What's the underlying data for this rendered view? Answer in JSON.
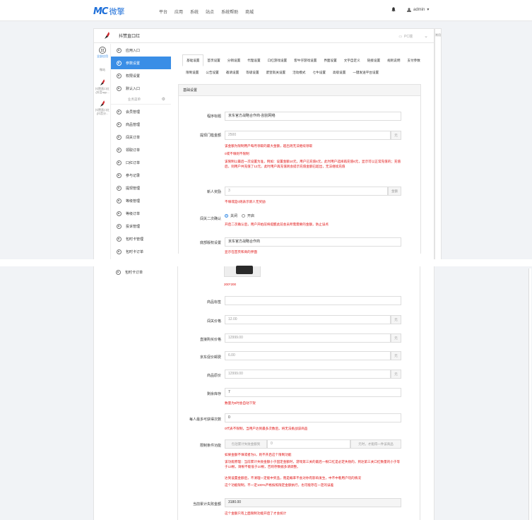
{
  "brand": {
    "logo_mark": "MC",
    "logo_text": "微擎",
    "accent": "#1e6fd9"
  },
  "topnav": [
    "平台",
    "应用",
    "系统",
    "站点",
    "系统帮助",
    "商城"
  ],
  "user": {
    "name": "admin"
  },
  "app": {
    "name": "抖赞直口红",
    "device_label": "PC端"
  },
  "right_edge": "常用",
  "icon_col": [
    {
      "label": "全部应用"
    },
    {
      "label": "微站"
    },
    {
      "label": "抖赞直口红 (抖音app..."
    },
    {
      "label": "抖赞直口红 (抖音分..."
    }
  ],
  "sidebar": {
    "top_items": [
      "应用入口",
      "参数设置",
      "权限设置",
      "默认入口"
    ],
    "section_title": "业务菜单",
    "section_items": [
      "会员管理",
      "商品管理",
      "闯关订单",
      "领取订单",
      "口红订单",
      "参与记录",
      "提现管理",
      "等级管理",
      "等级订单",
      "投诉管理",
      "包时卡管理",
      "包时卡订单",
      "包时卡订单"
    ]
  },
  "tabs": [
    "基础设置",
    "首页设置",
    "分销设置",
    "代理设置",
    "口红游戏设置",
    "客牛仔游戏设置",
    "界面设置",
    "文字自定义",
    "链接设置",
    "规则说明",
    "支付参数",
    "限制设置",
    "公告设置",
    "邀请设置",
    "等级设置",
    "废登就关设置",
    "活动模式",
    "七牛设置",
    "高级设置",
    "一键发送平台设置"
  ],
  "panel_title": "基础设置",
  "form_top": {
    "title_label": "程序标题",
    "title_value": "京东官方战略合作商-刮刮网络",
    "withdraw_label": "提现门槛金额",
    "withdraw_value": "2500",
    "withdraw_unit": "元",
    "hint1": "该金额为限制用户每月领取的最大金额，超出则无法继续领取",
    "hint2": "0或不填则不限制",
    "hint3": "该限制以最后一次设置为准，例如：设置金额10元，用户已充值6元，此时用户选择再充值6元，显示可以正常充值的；充值后，则用户共充值了12元，此时用户再充值则会提示充值金额已超出，无法继续充值",
    "newuser_label": "新人奖励",
    "newuser_value": "3",
    "newuser_unit": "金额",
    "newuser_hint": "不填或是0则表示新人无奖励",
    "confirm_label": "闯关二次确认",
    "confirm_off": "关闭",
    "confirm_on": "开启",
    "confirm_hint": "开启二次确认后，用户开始前将提醒此前会员所需需要的金额，防止误点",
    "cover_label": "底部版权设置",
    "cover_value": "京东官方战略合作商",
    "cover_hint": "显示在首页和商的界面"
  },
  "form_bottom": {
    "image_size": "200*200",
    "goods_label": "商品标签",
    "goods_value": "",
    "pass_price_label": "闯关价格",
    "pass_price_value": "12.00",
    "pass_price_unit": "元",
    "direct_price_label": "直接购买价格",
    "direct_price_value": "12999.00",
    "direct_price_unit": "元",
    "jd_price_label": "京东促价邮费",
    "jd_price_value": "6.00",
    "jd_price_unit": "元",
    "orig_price_label": "商品原价",
    "orig_price_value": "12999.00",
    "orig_price_unit": "元",
    "stock_label": "剩余库存",
    "stock_value": "7",
    "stock_hint": "数量为0时会自动下架",
    "max_label": "每人最多可获得次数",
    "max_value": "0",
    "max_hint": "0代表不限制，当用户达到最多次数后，将无法挑战该商品",
    "limit_label": "限制条件功能",
    "limit_placeholder": "包括累计失败金额到",
    "limit_value": "0",
    "limit_suffix": "元时，才能得一件该商品",
    "limit_hint1": "如果金额不填或者为0，则不开启这个限制功能",
    "limit_hint2": "该功能原理：当前累计失败金额小于固定金额时，游戏第三关的最后一根口红是必定失败的，到达第三关口红数量的小于等于13根，请根不能低于10根，否则存数据多请调整。",
    "limit_hint3": "达到设置金额后，不清理一定能中奖品，而是概率不会对你有影响发生，中不中看用户玩的情况",
    "limit_hint4": "这个功能限制，不一定100%严格按照限定金额执行，也可能存在一定的误差",
    "total_label": "当前累计失败金额",
    "total_value": "3180.00",
    "total_hint": "这个金额只有上面限制功能开启了才会统计"
  }
}
